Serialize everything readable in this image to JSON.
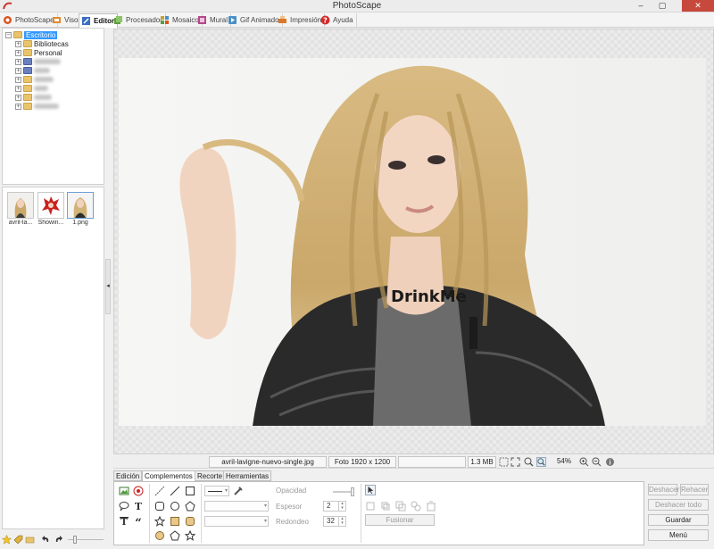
{
  "window": {
    "title": "PhotoScape",
    "minimize": "–",
    "maximize": "▢",
    "close": "✕"
  },
  "tabs": [
    {
      "label": "PhotoScape",
      "icon": "photoscape-icon",
      "color": "#d9531e"
    },
    {
      "label": "Visor",
      "icon": "viewer-icon",
      "color": "#e08a2a"
    },
    {
      "label": "Editor",
      "icon": "editor-icon",
      "color": "#3a6ebf",
      "active": true
    },
    {
      "label": "Procesador",
      "icon": "batch-icon",
      "color": "#5a9e3c"
    },
    {
      "label": "Mosaico",
      "icon": "page-icon",
      "color": "#c8a030"
    },
    {
      "label": "Mural",
      "icon": "combine-icon",
      "color": "#b04a8a"
    },
    {
      "label": "Gif Animado",
      "icon": "gif-icon",
      "color": "#4a90c8"
    },
    {
      "label": "Impresión",
      "icon": "print-icon",
      "color": "#d9782a"
    },
    {
      "label": "Ayuda",
      "icon": "help-icon",
      "color": "#d42c2c"
    }
  ],
  "folder_tree": {
    "root": "Escritorio",
    "items": [
      "Bibliotecas",
      "Personal"
    ]
  },
  "thumbnails": [
    {
      "label": "avril-la..."
    },
    {
      "label": "Showin..."
    },
    {
      "label": "1.png"
    }
  ],
  "photo": {
    "overlay_text": "DrinkMe"
  },
  "status": {
    "filename": "avril-lavigne-nuevo-single.jpg",
    "info": "Foto 1920 x 1200",
    "size": "1.3 MB",
    "zoom": "54%"
  },
  "bottom_tabs": [
    "Edición",
    "Complementos",
    "Recorte",
    "Herramientas"
  ],
  "options": {
    "opacity_label": "Opacidad",
    "thickness_label": "Espesor",
    "thickness_value": "2",
    "round_label": "Redondeo",
    "round_value": "32",
    "merge_button": "Fusionar"
  },
  "actions": {
    "undo": "Deshacer",
    "redo": "Rehacer",
    "undo_all": "Deshacer todo",
    "save": "Guardar",
    "menu": "Menú"
  }
}
